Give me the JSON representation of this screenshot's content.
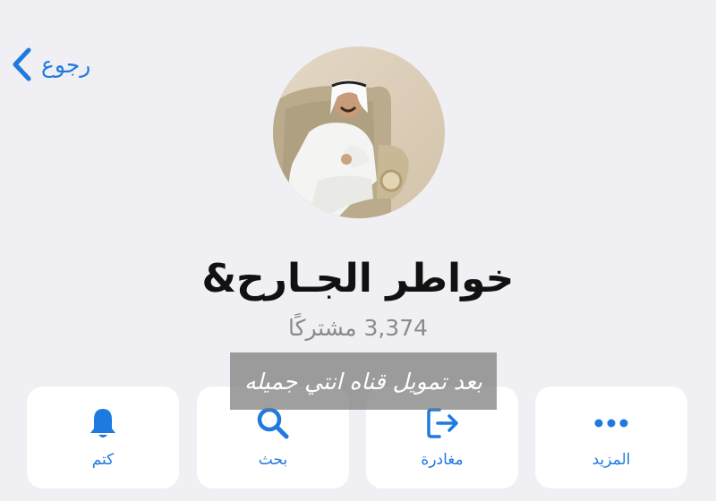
{
  "header": {
    "back_label": "رجوع"
  },
  "channel": {
    "title": "خواطر الجـارح&",
    "subscribers": "3,374 مشتركًا"
  },
  "overlay": {
    "text": "بعد تمويل قناه انتي جميله"
  },
  "actions": [
    {
      "label": "كتم",
      "icon": "bell-icon"
    },
    {
      "label": "بحث",
      "icon": "search-icon"
    },
    {
      "label": "مغادرة",
      "icon": "leave-icon"
    },
    {
      "label": "المزيد",
      "icon": "more-icon"
    }
  ],
  "colors": {
    "accent": "#1f7ae0",
    "background": "#efeff4",
    "card": "#ffffff"
  }
}
